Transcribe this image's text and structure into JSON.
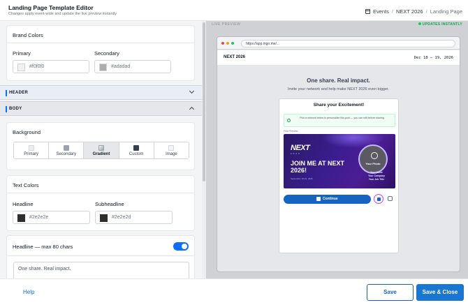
{
  "header": {
    "title": "Landing Page Template Editor",
    "subtitle": "Changes apply event-wide and update the live preview instantly",
    "breadcrumb": [
      "Events",
      "NEXT 2026",
      "Landing Page"
    ]
  },
  "brand_colors": {
    "title": "Brand Colors",
    "primary_label": "Primary",
    "primary_value": "#f0f0f0",
    "secondary_label": "Secondary",
    "secondary_value": "#adadad"
  },
  "sections": {
    "header_label": "HEADER",
    "body_label": "BODY"
  },
  "background": {
    "title": "Background",
    "options": [
      "Primary",
      "Secondary",
      "Gradient",
      "Custom",
      "Image"
    ],
    "selected": "Gradient"
  },
  "text_colors": {
    "title": "Text Colors",
    "headline_label": "Headline",
    "headline_value": "#2e2e2e",
    "subheadline_label": "Subheadline",
    "subheadline_value": "#2e2e2d"
  },
  "headline_field": {
    "label": "Headline — max 80 chars",
    "enabled": true,
    "value": "One share. Real impact."
  },
  "preview": {
    "live_label": "LIVE PREVIEW",
    "status": "UPDATES INSTANTLY",
    "url": "https://app.ingo.me/...",
    "site_brand": "NEXT 2026",
    "site_dates": "Dec 18 – 19, 2026",
    "hero_title": "One share. Real impact.",
    "hero_sub": "Invite your network and help make NEXT 2026 even bigger.",
    "card_title": "Share your Excitement!",
    "notice": "Pick a network below to personalize this post — you can edit before sharing.",
    "post_preview_label": "Post Preview",
    "banner": {
      "logo": "NEXT",
      "logo_sub": "2026",
      "headline": "JOIN ME AT NEXT 2026!",
      "date": "September 18-19, 2026",
      "photo_label": "Your Photo",
      "who": [
        "Your Name",
        "Your Company",
        "Your Job Title"
      ]
    },
    "continue_label": "Continue"
  },
  "footer": {
    "help_label": "Help",
    "save_label": "Save",
    "save_close_label": "Save & Close"
  },
  "colors": {
    "accent": "#1565c0",
    "primary_button": "#1976d2",
    "status_green": "#16a34a"
  }
}
